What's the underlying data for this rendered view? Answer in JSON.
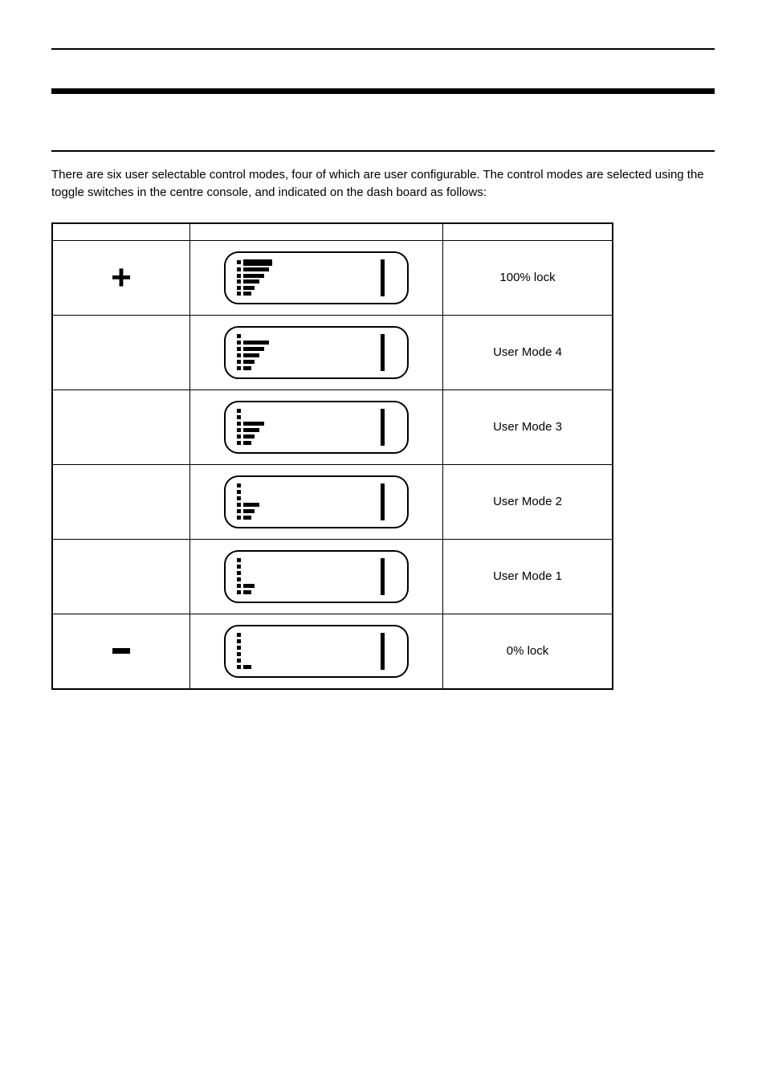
{
  "intro_part1": "There are six user selectable control modes, four of which are user configurable. The control modes are selected using the",
  "intro_part2": " toggle switches in the centre console, and indicated on the dash board as follows:",
  "headers": {
    "switch": "",
    "dash": "",
    "mode": ""
  },
  "rows": [
    {
      "switch": "plus",
      "mode": "100% lock",
      "bars": [
        36,
        32,
        26,
        20,
        14,
        10
      ]
    },
    {
      "switch": "",
      "mode": "User Mode 4",
      "bars": [
        0,
        32,
        26,
        20,
        14,
        10
      ]
    },
    {
      "switch": "",
      "mode": "User Mode 3",
      "bars": [
        0,
        0,
        26,
        20,
        14,
        10
      ]
    },
    {
      "switch": "",
      "mode": "User Mode 2",
      "bars": [
        0,
        0,
        0,
        20,
        14,
        10
      ]
    },
    {
      "switch": "",
      "mode": "User Mode 1",
      "bars": [
        0,
        0,
        0,
        0,
        14,
        10
      ]
    },
    {
      "switch": "minus",
      "mode": "0% lock",
      "bars": [
        0,
        0,
        0,
        0,
        0,
        10
      ]
    }
  ]
}
